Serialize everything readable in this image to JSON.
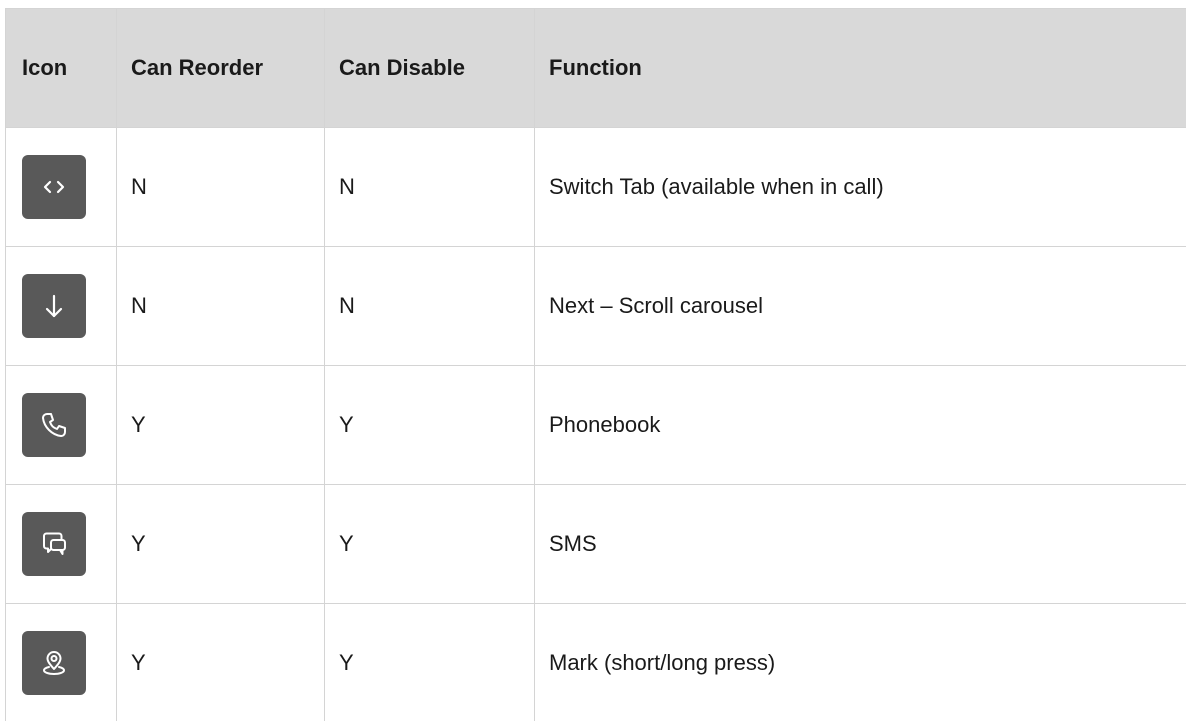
{
  "headers": {
    "icon": "Icon",
    "can_reorder": "Can Reorder",
    "can_disable": "Can Disable",
    "function": "Function"
  },
  "rows": [
    {
      "icon": "code-brackets-icon",
      "can_reorder": "N",
      "can_disable": "N",
      "function": "Switch Tab (available when in call)"
    },
    {
      "icon": "arrow-down-icon",
      "can_reorder": "N",
      "can_disable": "N",
      "function": "Next – Scroll carousel"
    },
    {
      "icon": "phone-icon",
      "can_reorder": "Y",
      "can_disable": "Y",
      "function": "Phonebook"
    },
    {
      "icon": "chat-bubbles-icon",
      "can_reorder": "Y",
      "can_disable": "Y",
      "function": "SMS"
    },
    {
      "icon": "map-pin-icon",
      "can_reorder": "Y",
      "can_disable": "Y",
      "function": "Mark (short/long press)"
    }
  ],
  "colors": {
    "header_bg": "#d9d9d9",
    "icon_bg": "#595959",
    "grid": "#d4d4d4"
  }
}
